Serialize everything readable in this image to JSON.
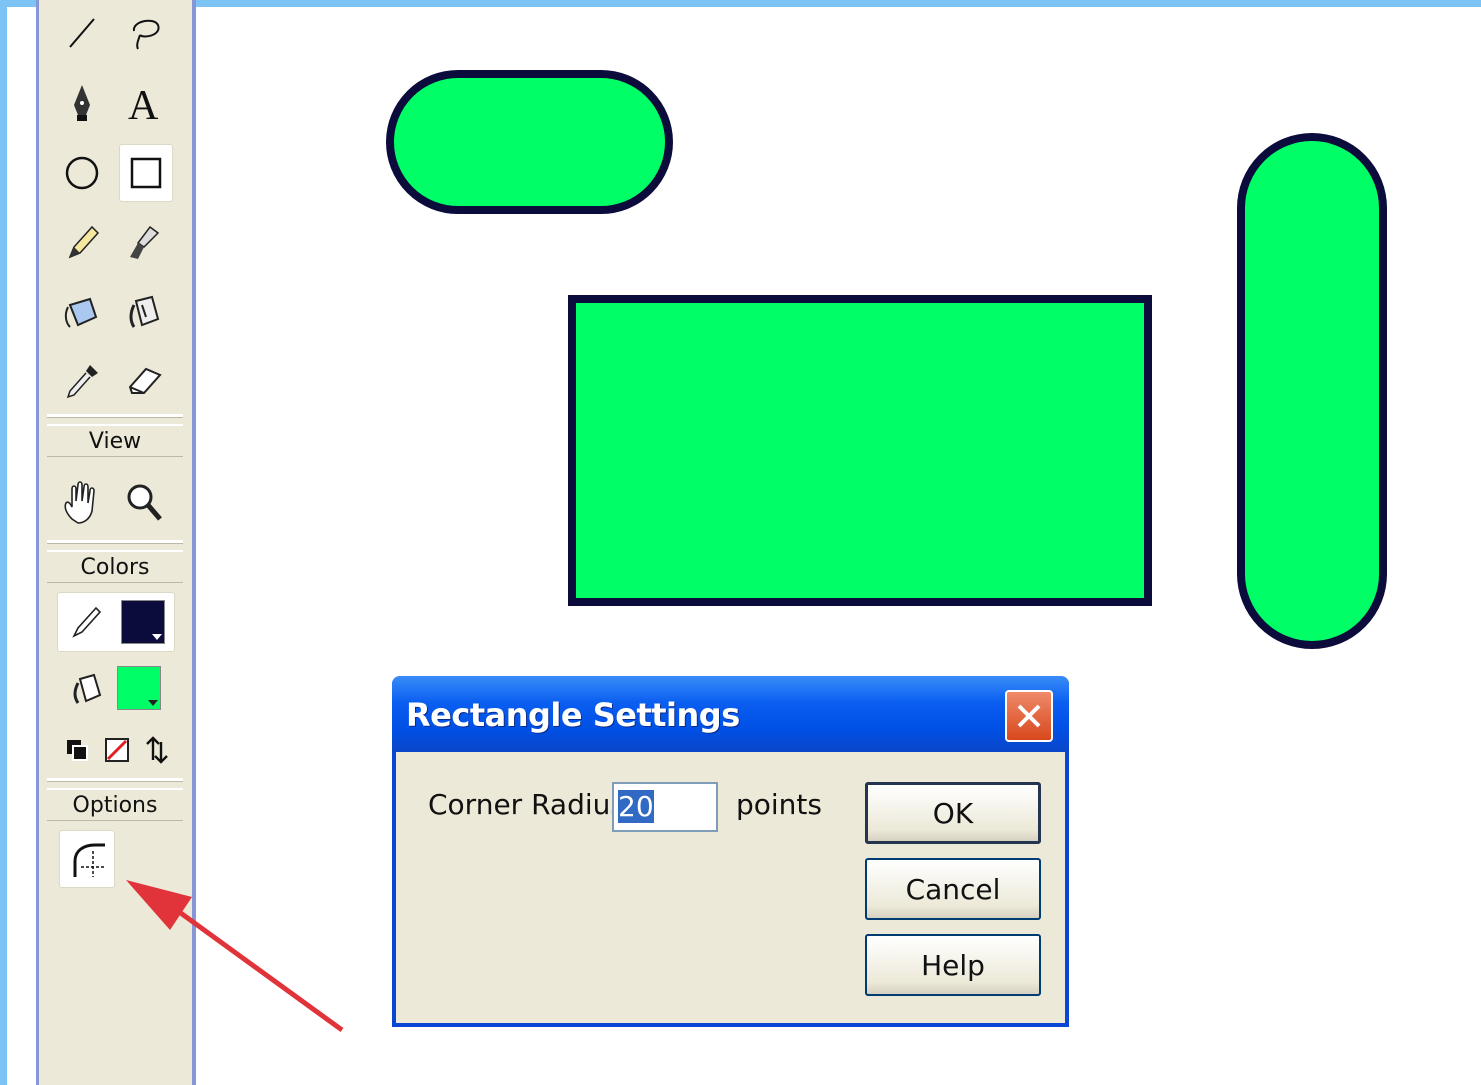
{
  "toolbar": {
    "tools": [
      {
        "name": "line-tool",
        "icon": "line-icon"
      },
      {
        "name": "lasso-tool",
        "icon": "lasso-icon"
      },
      {
        "name": "pen-tool",
        "icon": "pen-icon"
      },
      {
        "name": "text-tool",
        "icon": "text-icon"
      },
      {
        "name": "oval-tool",
        "icon": "oval-icon"
      },
      {
        "name": "rectangle-tool",
        "icon": "rectangle-icon",
        "active": true
      },
      {
        "name": "pencil-tool",
        "icon": "pencil-icon"
      },
      {
        "name": "brush-tool",
        "icon": "brush-icon"
      },
      {
        "name": "ink-bottle-tool",
        "icon": "ink-bottle-icon"
      },
      {
        "name": "paint-bucket-tool",
        "icon": "paint-bucket-icon"
      },
      {
        "name": "eyedropper-tool",
        "icon": "eyedropper-icon"
      },
      {
        "name": "eraser-tool",
        "icon": "eraser-icon"
      }
    ],
    "view_label": "View",
    "colors_label": "Colors",
    "options_label": "Options",
    "stroke_color": "#0b0b3c",
    "fill_color": "#00ff66"
  },
  "canvas": {
    "shape_fill": "#00ff66",
    "shape_stroke": "#0b0b3c"
  },
  "dialog": {
    "title": "Rectangle Settings",
    "corner_radius_label": "Corner Radius:",
    "corner_radius_value": "20",
    "units_label": "points",
    "ok_label": "OK",
    "cancel_label": "Cancel",
    "help_label": "Help"
  },
  "annotation": {
    "arrow_color": "#e0343a"
  }
}
